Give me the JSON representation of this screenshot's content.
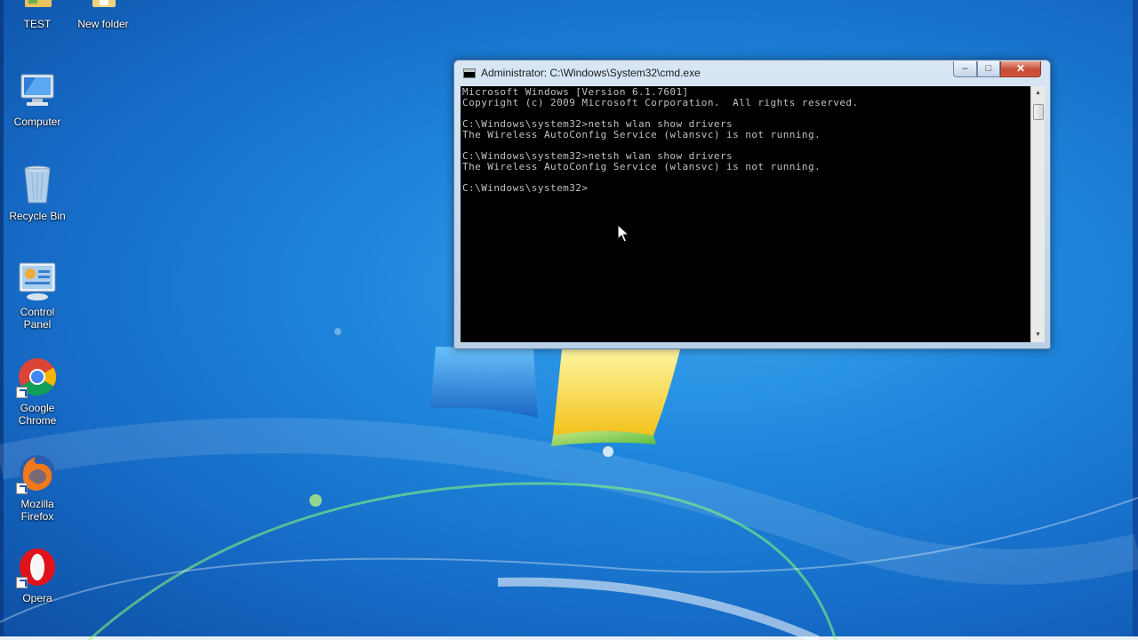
{
  "desktop": {
    "icons": [
      {
        "label": "TEST",
        "icon": "folder-icon"
      },
      {
        "label": "New folder",
        "icon": "folder-icon"
      },
      {
        "label": "Computer",
        "icon": "computer-icon"
      },
      {
        "label": "Recycle Bin",
        "icon": "recycle-bin-icon"
      },
      {
        "label": "Control\nPanel",
        "icon": "control-panel-icon"
      },
      {
        "label": "Google\nChrome",
        "icon": "chrome-icon"
      },
      {
        "label": "Mozilla\nFirefox",
        "icon": "firefox-icon"
      },
      {
        "label": "Opera",
        "icon": "opera-icon"
      }
    ]
  },
  "window": {
    "title": "Administrator: C:\\Windows\\System32\\cmd.exe",
    "buttons": {
      "minimize": "–",
      "maximize": "□",
      "close": "✕"
    },
    "console_lines": [
      "Microsoft Windows [Version 6.1.7601]",
      "Copyright (c) 2009 Microsoft Corporation.  All rights reserved.",
      "",
      "C:\\Windows\\system32>netsh wlan show drivers",
      "The Wireless AutoConfig Service (wlansvc) is not running.",
      "",
      "C:\\Windows\\system32>netsh wlan show drivers",
      "The Wireless AutoConfig Service (wlansvc) is not running.",
      "",
      "C:\\Windows\\system32>"
    ]
  },
  "colors": {
    "console_bg": "#000000",
    "console_text": "#c0c0c0",
    "desktop_blue": "#1e86dc",
    "close_red": "#c64a35"
  }
}
